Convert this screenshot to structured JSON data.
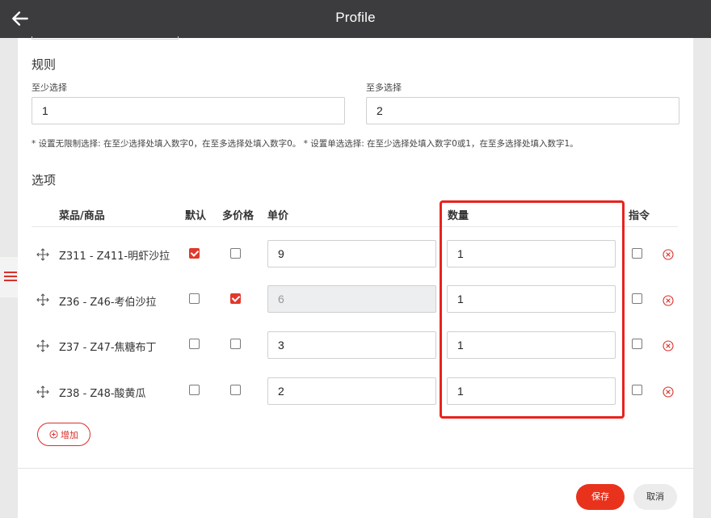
{
  "header": {
    "title": "Profile"
  },
  "rules": {
    "section_title": "规则",
    "min_label": "至少选择",
    "min_value": "1",
    "max_label": "至多选择",
    "max_value": "2",
    "hint": "* 设置无限制选择: 在至少选择处填入数字0，在至多选择处填入数字0。 * 设置单选选择: 在至少选择处填入数字0或1，在至多选择处填入数字1。"
  },
  "options": {
    "section_title": "选项",
    "columns": {
      "item": "菜品/商品",
      "default": "默认",
      "multi_price": "多价格",
      "price": "单价",
      "quantity": "数量",
      "command": "指令"
    },
    "rows": [
      {
        "name": "Z311 - Z411-明虾沙拉",
        "default": true,
        "multi_price": false,
        "price": "9",
        "price_disabled": false,
        "quantity": "1",
        "command": false
      },
      {
        "name": "Z36 - Z46-考伯沙拉",
        "default": false,
        "multi_price": true,
        "price": "6",
        "price_disabled": true,
        "quantity": "1",
        "command": false
      },
      {
        "name": "Z37 - Z47-焦糖布丁",
        "default": false,
        "multi_price": false,
        "price": "3",
        "price_disabled": false,
        "quantity": "1",
        "command": false
      },
      {
        "name": "Z38 - Z48-酸黄瓜",
        "default": false,
        "multi_price": false,
        "price": "2",
        "price_disabled": false,
        "quantity": "1",
        "command": false
      }
    ],
    "add_label": "增加"
  },
  "footer": {
    "save_label": "保存",
    "cancel_label": "取消"
  },
  "icons": {
    "back": "arrow-left-icon",
    "drag": "move-icon",
    "delete": "circle-x-icon",
    "add": "plus-circle-icon",
    "menu": "hamburger-icon"
  },
  "colors": {
    "accent": "#e8321c",
    "highlight": "#e8231d",
    "topbar": "#3c3c3e"
  }
}
